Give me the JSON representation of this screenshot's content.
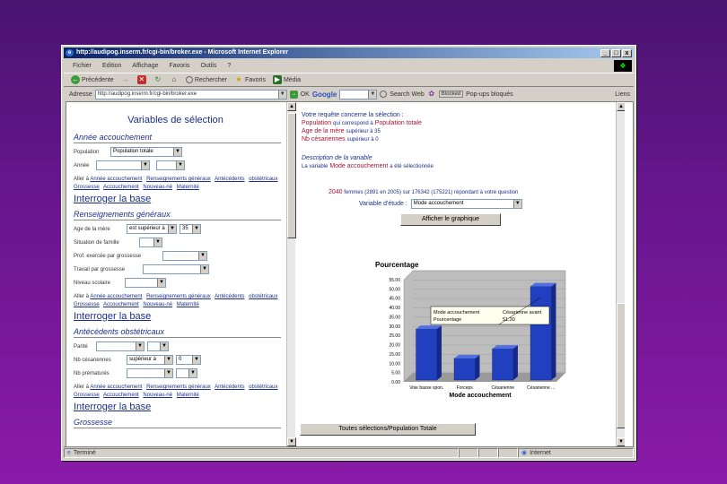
{
  "window": {
    "title": "http://audipog.inserm.fr/cgi-bin/broker.exe - Microsoft Internet Explorer",
    "ie_icon": "e",
    "minimize": "_",
    "maximize": "□",
    "close": "x"
  },
  "menu": [
    "Fichier",
    "Edition",
    "Affichage",
    "Favoris",
    "Outils",
    "?"
  ],
  "windows_logo": "❖",
  "toolbar": {
    "back": "Précédente",
    "forward_icon": "→",
    "stop_icon": "✕",
    "refresh_icon": "↻",
    "home_icon": "⌂",
    "search": "Rechercher",
    "favorites": "Favoris",
    "media": "Média"
  },
  "address": {
    "label": "Adresse",
    "url": "http://audipog.inserm.fr/cgi-bin/broker.exe",
    "ok": "OK",
    "google": "Google",
    "search_web": "Search Web",
    "links": "Liens",
    "ad_blocker": "Blocked",
    "popups": "Pop-ups bloqués"
  },
  "left": {
    "title": "Variables de sélection",
    "sect1": "Année accouchement",
    "population_label": "Population",
    "population_value": "Population totale",
    "annee_label": "Année",
    "allerA": "Aller à",
    "links1": [
      "Année accouchement",
      "Renseignements généraux",
      "Antécédents",
      "obstétricaux",
      "Grossesse",
      "Accouchement",
      "Nouveau-né",
      "Maternité"
    ],
    "query": "Interroger la base",
    "sect2": "Renseignements généraux",
    "age_label": "Age de la mère",
    "age_op": "est supérieur à",
    "age_val": "35",
    "situation_label": "Situation de famille",
    "prof_label": "Prof. exercée par grossesse",
    "travail_label": "Travail par grossesse",
    "niveau_label": "Niveau scolaire",
    "links2": [
      "Année accouchement",
      "Renseignements généraux",
      "Antécédents",
      "obstétricaux",
      "Grossesse",
      "Accouchement",
      "Nouveau-né",
      "Maternité"
    ],
    "query2": "Interroger la base",
    "sect3": "Antécédents obstétricaux",
    "parite_label": "Parité",
    "nb_cesar_label": "Nb césariennes",
    "nb_cesar_op": "supérieur à",
    "nb_cesar_val": "0",
    "nb_premature_label": "Nb prématurés",
    "links3": [
      "Année accouchement",
      "Renseignements généraux",
      "Antécédents",
      "obstétricaux",
      "Grossesse",
      "Accouchement",
      "Nouveau-né",
      "Maternité"
    ],
    "query3": "Interroger la base",
    "sect4": "Grossesse"
  },
  "right": {
    "intro": "Votre requête concerne la sélection :",
    "pop_label": "Population",
    "pop_mid": "qui correspond à",
    "pop_value": "Population totale",
    "age_line_label": "Age de la mère",
    "age_line_value": "supérieur à 35",
    "nbc_line_label": "Nb césariennes",
    "nbc_line_value": "supérieur à 0",
    "desc_label": "Description de la variable",
    "desc_prefix": "La variable",
    "desc_var": "Mode accouchement",
    "desc_suffix": "a été sélectionnée",
    "count_num": "2040",
    "count_text": "femmes (2891 en 2005) sur 176342 (175221) répondant à votre question",
    "var_label": "Variable d'étude :",
    "var_value": "Mode accouchement",
    "show_chart": "Afficher le graphique",
    "all_selected": "Toutes sélections/Population Totale"
  },
  "chart_data": {
    "type": "bar",
    "title": "Pourcentage",
    "xlabel": "Mode accouchement",
    "ylabel": "",
    "categories": [
      "Voie basse spon.",
      "Forceps",
      "Césarienne",
      "Césarienne ..."
    ],
    "values": [
      28.4,
      12.6,
      17.8,
      51.3
    ],
    "yticks": [
      "0.00",
      "5.00",
      "10.00",
      "15.00",
      "20.00",
      "25.00",
      "30.00",
      "35.00",
      "40.00",
      "45.00",
      "50.00",
      "55.00"
    ],
    "ylim": [
      0,
      55
    ],
    "bar_color": "#2040c0",
    "tooltip": {
      "row1_label": "Mode accouchement",
      "row1_value": "Césarienne avant",
      "row2_label": "Pourcentage",
      "row2_value": "51,30"
    }
  },
  "status": {
    "text": "Terminé",
    "zone": "Internet"
  }
}
